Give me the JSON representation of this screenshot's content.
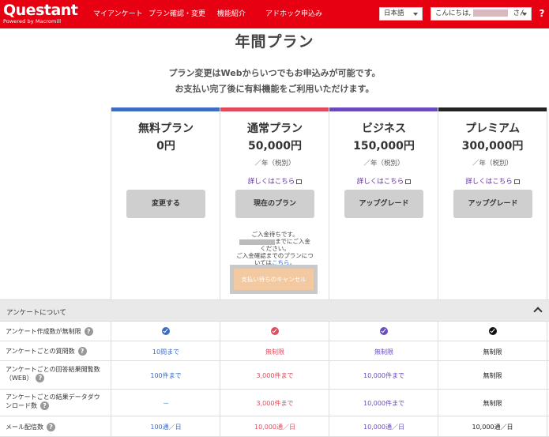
{
  "header": {
    "logo_text": "Questant",
    "logo_sub": "Powered by Macromill",
    "nav": [
      "マイアンケート",
      "プラン確認・変更",
      "機能紹介",
      "アドホック申込み"
    ],
    "language": "日本語",
    "greeting_prefix": "こんにちは,",
    "greeting_suffix": "さん",
    "help": "?"
  },
  "page": {
    "title": "年間プラン",
    "subtitle1": "プラン変更はWebからいつでもお申込みが可能です。",
    "subtitle2": "お支払い完了後に有料機能をご利用いただけます。"
  },
  "plans": [
    {
      "name": "無料プラン",
      "price": "0円",
      "unit": "",
      "link": "",
      "button": "変更する",
      "color": "#3c6cc4"
    },
    {
      "name": "通常プラン",
      "price": "50,000円",
      "unit": "／年（税別）",
      "link": "詳しくはこちら",
      "button": "現在のプラン",
      "color": "#e04a5c"
    },
    {
      "name": "ビジネス",
      "price": "150,000円",
      "unit": "／年（税別）",
      "link": "詳しくはこちら",
      "button": "アップグレード",
      "color": "#6a4bbf"
    },
    {
      "name": "プレミアム",
      "price": "300,000円",
      "unit": "／年（税別）",
      "link": "詳しくはこちら",
      "button": "アップグレード",
      "color": "#222222"
    }
  ],
  "notice": {
    "line1": "ご入金待ちです。",
    "line2": "までにご入金",
    "line3": "ください。",
    "line4": "ご入金確認までのプランにつ",
    "line5_pre": "いては",
    "line5_link": "こちら",
    "line5_post": "。",
    "cancel": "支払い待ちのキャンセル"
  },
  "section": {
    "title": "アンケートについて"
  },
  "rows": [
    {
      "label": "アンケート作成数が無制限",
      "values": [
        "check",
        "check",
        "check",
        "check"
      ]
    },
    {
      "label": "アンケートごとの質問数",
      "values": [
        "10問まで",
        "無制限",
        "無制限",
        "無制限"
      ]
    },
    {
      "label1": "アンケートごとの回答結果閲覧数",
      "label2": "（WEB）",
      "values": [
        "100件まで",
        "3,000件まで",
        "10,000件まで",
        "無制限"
      ]
    },
    {
      "label1": "アンケートごとの結果データダウ",
      "label2": "ンロード数",
      "values": [
        "－",
        "3,000件まで",
        "10,000件まで",
        "無制限"
      ]
    },
    {
      "label": "メール配信数",
      "values": [
        "100通／日",
        "10,000通／日",
        "10,000通／日",
        "10,000通／日"
      ]
    }
  ],
  "colors": {
    "brand": "#e60012",
    "free": "#3c6cc4",
    "standard": "#e04a5c",
    "business": "#6a4bbf",
    "premium": "#222222"
  }
}
